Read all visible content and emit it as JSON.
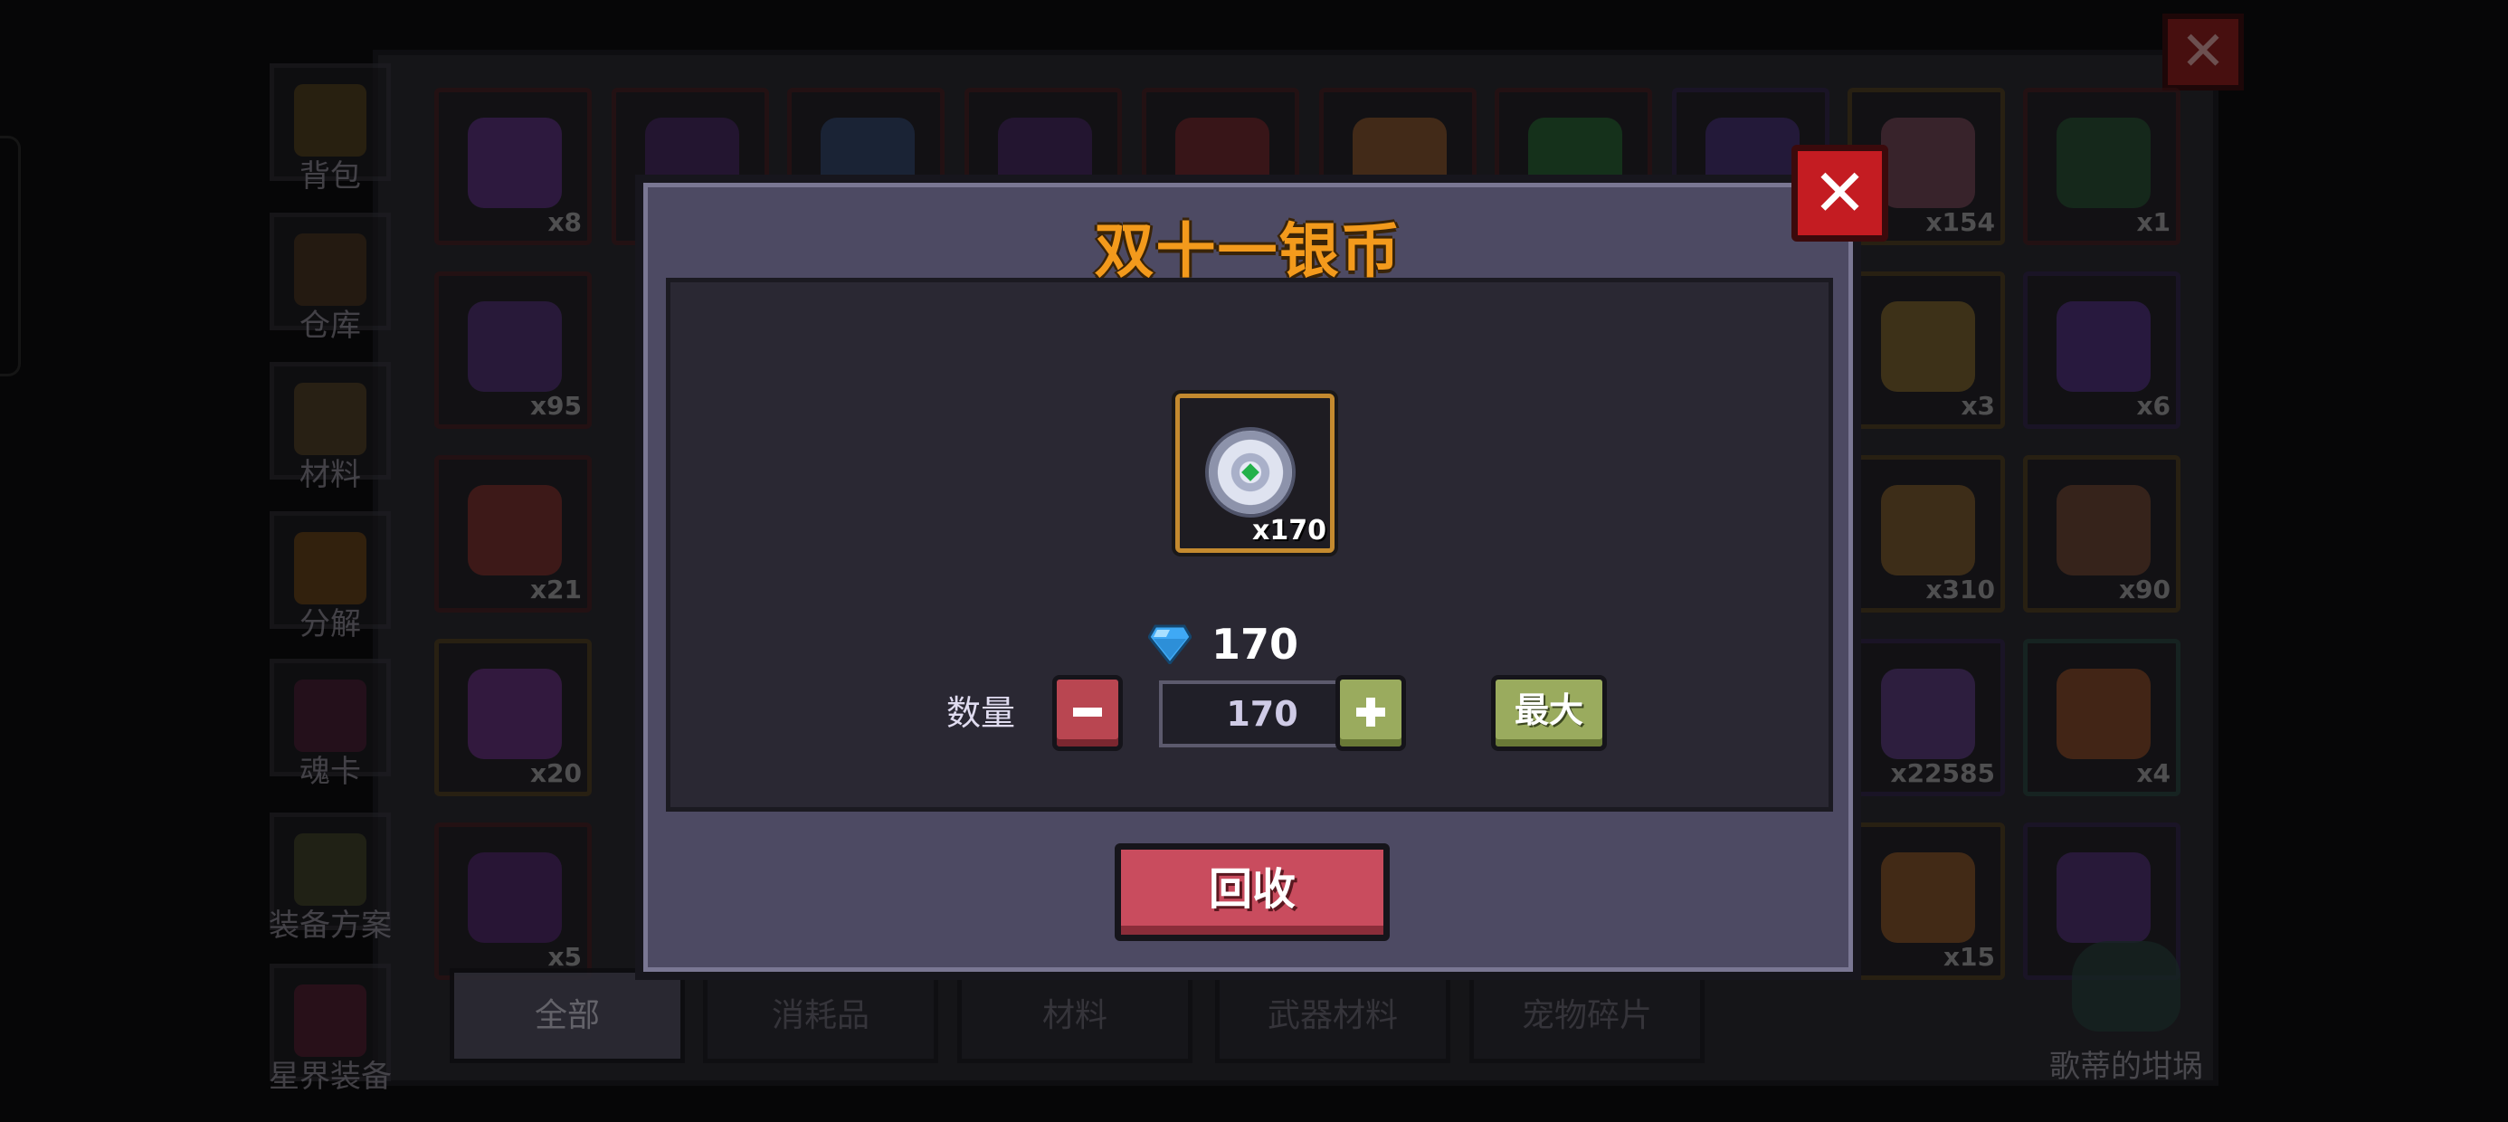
{
  "inventory": {
    "categories": [
      {
        "label": "背包",
        "icon": "backpack-icon",
        "color": "#8a6a2a"
      },
      {
        "label": "仓库",
        "icon": "warehouse-chest-icon",
        "color": "#7a5530"
      },
      {
        "label": "材料",
        "icon": "materials-icon",
        "color": "#8a6a3a"
      },
      {
        "label": "分解",
        "icon": "decompose-icon",
        "color": "#b07020"
      },
      {
        "label": "魂卡",
        "icon": "soul-card-icon",
        "color": "#7a3058"
      },
      {
        "label": "装备方案",
        "icon": "equipment-plan-icon",
        "color": "#6a7040"
      },
      {
        "label": "星界装备",
        "icon": "astral-equipment-icon",
        "color": "#8a3050"
      }
    ],
    "slot_counts": {
      "r1c1": "x8",
      "r1c9": "x154",
      "r1c10": "x1",
      "r2c1": "x95",
      "r2c9": "x3",
      "r2c10": "x6",
      "r3c1": "x21",
      "r3c9": "x310",
      "r3c10": "x90",
      "r4c1": "x20",
      "r4c9": "x22585",
      "r4c10": "x4",
      "r5c1": "x5",
      "r5c9": "x15"
    },
    "filter_tabs": [
      "全部",
      "消耗品",
      "材料",
      "武器材料",
      "宠物碎片"
    ],
    "cauldron_label": "歌蒂的坩埚"
  },
  "modal": {
    "title": "双十一银币",
    "item": {
      "icon": "silver-coin-icon",
      "count": "x170"
    },
    "price": {
      "icon": "blue-gem-icon",
      "value": "170"
    },
    "quantity_label": "数量",
    "quantity_value": "170",
    "max_label": "最大",
    "recycle_label": "回收",
    "close_symbol": "✕"
  },
  "colors": {
    "title_orange": "#f39a1c",
    "close_red": "#c41c22",
    "recycle_red": "#c94c5e",
    "green_button": "#9aab5e",
    "item_border_gold": "#c48a2f",
    "gem_blue": "#3fa9f5"
  }
}
